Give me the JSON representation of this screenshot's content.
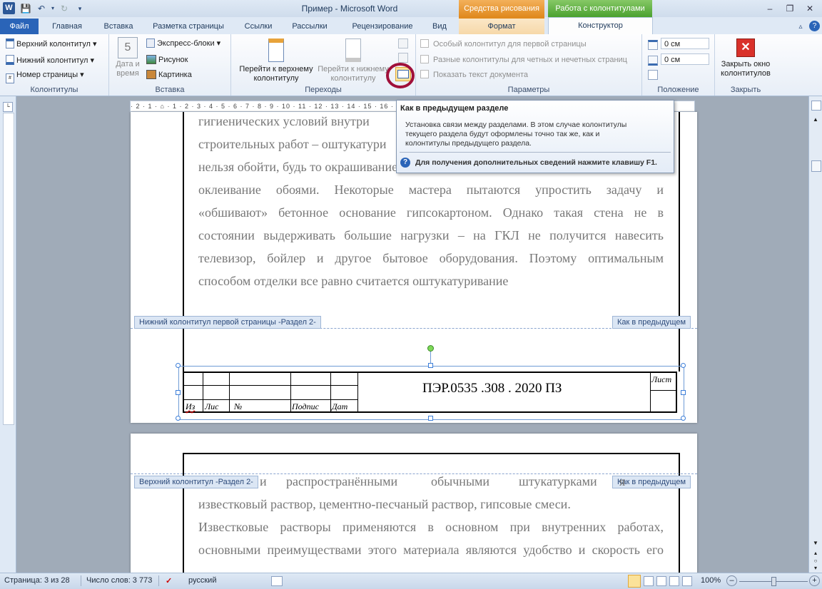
{
  "window": {
    "title": "Пример - Microsoft Word",
    "app_icon": "W",
    "context_tabs": {
      "drawing": "Средства рисования",
      "header_footer": "Работа с колонтитулами"
    }
  },
  "tabs": [
    "Файл",
    "Главная",
    "Вставка",
    "Разметка страницы",
    "Ссылки",
    "Рассылки",
    "Рецензирование",
    "Вид",
    "Формат",
    "Конструктор"
  ],
  "ribbon": {
    "hf_group": {
      "label": "Колонтитулы",
      "header": "Верхний колонтитул",
      "footer": "Нижний колонтитул",
      "page_number": "Номер страницы"
    },
    "insert_group": {
      "label": "Вставка",
      "date_time_line1": "Дата и",
      "date_time_line2": "время",
      "quick_parts": "Экспресс-блоки",
      "picture": "Рисунок",
      "clipart": "Картинка"
    },
    "nav_group": {
      "label": "Переходы",
      "goto_header_line1": "Перейти к верхнему",
      "goto_header_line2": "колонтитулу",
      "goto_footer_line1": "Перейти к нижнему",
      "goto_footer_line2": "колонтитулу"
    },
    "options_group": {
      "label": "Параметры",
      "first_page": "Особый колонтитул для первой страницы",
      "odd_even": "Разные колонтитулы для четных и нечетных страниц",
      "show_text": "Показать текст документа"
    },
    "position_group": {
      "label": "Положение",
      "header_pos": "0 см",
      "footer_pos": "0 см"
    },
    "close_group": {
      "label": "Закрыть",
      "close_line1": "Закрыть окно",
      "close_line2": "колонтитулов"
    }
  },
  "tooltip": {
    "title": "Как в предыдущем разделе",
    "line1": "Установка связи между разделами. В этом случае колонтитулы",
    "line2": "текущего раздела будут оформлены точно так же, как и",
    "line3": "колонтитулы предыдущего раздела.",
    "help": "Для получения дополнительных сведений нажмите клавишу F1."
  },
  "ruler": {
    "marks": "· 2 · 1 · ⌂ · 1 · 2 · 3 · 4 · 5 · 6 · 7 · 8 · 9 · 10 · 11 · 12 · 13 · 14 · 15 · 16 · 17 · ▵ 18 ·"
  },
  "page1": {
    "lines": [
      "гигиенических условий внутри",
      "строительных работ – оштукатури",
      "нельзя обойти, будь то окрашивание",
      "оклеивание обоями. Некоторые мастера пытаются упростить задачу и",
      "«обшивают» бетонное основание гипсокартоном. Однако такая стена не в",
      "состоянии выдерживать большие нагрузки – на ГКЛ не получится навесить",
      "телевизор, бойлер и другое бытовое оборудования. Поэтому оптимальным",
      "способом отделки все равно считается оштукатуривание"
    ],
    "footer_label": "Нижний колонтитул первой страницы -Раздел 2-",
    "same_as_prev": "Как в предыдущем"
  },
  "stamp": {
    "code": "ПЭР.0535 .308 . 2020  ПЗ",
    "sheet": "Лист",
    "cols": [
      "Из",
      "Лис",
      "№",
      "Подпис",
      "Дат"
    ]
  },
  "page2": {
    "header_label": "Верхний колонтитул -Раздел 2-",
    "same_as_prev": "Как в предыдущем",
    "line0_a": "и",
    "line0_b": "распространёнными",
    "line0_c": "обычными",
    "line0_d": "штукатурками",
    "line0_e": "я",
    "lines": [
      "известковый раствор, цементно-песчаный раствор, гипсовые смеси.",
      "Известковые растворы применяются в основном при внутренних работах,",
      "основными преимуществами этого материала являются удобство и скорость его"
    ]
  },
  "status": {
    "page": "Страница: 3 из 28",
    "words": "Число слов: 3 773",
    "lang": "русский",
    "zoom": "100%"
  },
  "colors": {
    "file_tab": "#2a64b8",
    "drawing_ctx": "#e08a1e",
    "hf_ctx": "#4aa12f",
    "close_red": "#d9312a",
    "annotation": "#a0103a"
  }
}
